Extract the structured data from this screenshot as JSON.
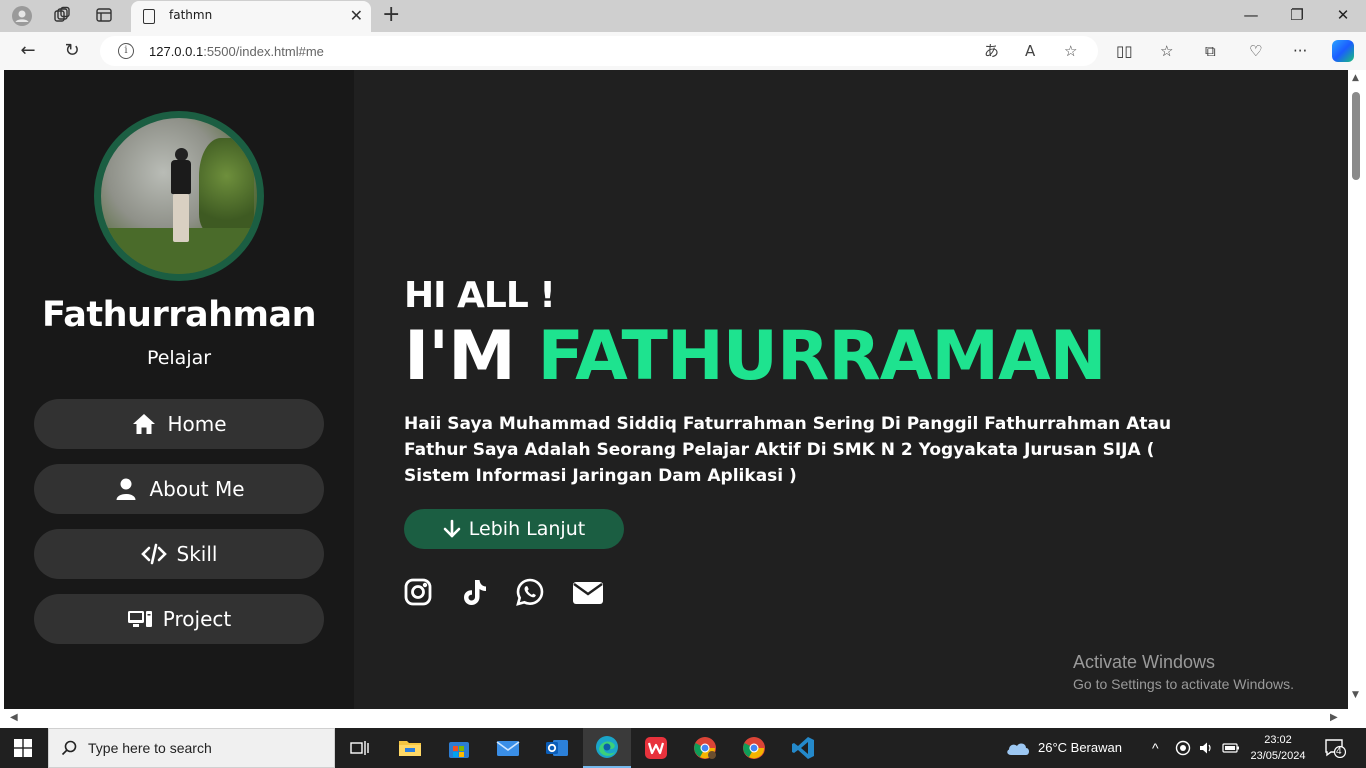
{
  "browser": {
    "tab_title": "fathmn",
    "url_host": "127.0.0.1",
    "url_rest": ":5500/index.html#me"
  },
  "sidebar": {
    "name": "Fathurrahman",
    "role": "Pelajar",
    "nav": [
      {
        "label": "Home",
        "icon": "home-icon"
      },
      {
        "label": "About Me",
        "icon": "user-icon"
      },
      {
        "label": "Skill",
        "icon": "code-icon"
      },
      {
        "label": "Project",
        "icon": "desktop-icon"
      }
    ]
  },
  "hero": {
    "greeting": "HI ALL !",
    "im_prefix": "I'M ",
    "im_name": "FATHURRAMAN",
    "intro": "Haii Saya Muhammad Siddiq Faturrahman Sering Di Panggil Fathurrahman Atau Fathur Saya Adalah Seorang Pelajar Aktif Di SMK N 2 Yogyakata Jurusan SIJA ( Sistem Informasi Jaringan Dam Aplikasi )",
    "more_button": "Lebih Lanjut",
    "socials": [
      "instagram-icon",
      "tiktok-icon",
      "whatsapp-icon",
      "email-icon"
    ]
  },
  "watermark": {
    "title": "Activate Windows",
    "subtitle": "Go to Settings to activate Windows."
  },
  "taskbar": {
    "search_placeholder": "Type here to search",
    "weather": "26°C  Berawan",
    "time": "23:02",
    "date": "23/05/2024",
    "notifications": "4"
  },
  "colors": {
    "accent": "#1ee38f",
    "brand_dark_green": "#1b5e42",
    "sidebar_bg": "#181818",
    "content_bg": "#202020"
  }
}
